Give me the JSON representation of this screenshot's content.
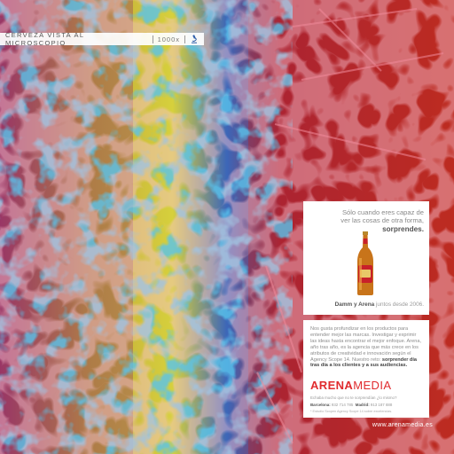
{
  "header": {
    "title": "CERVEZA VISTA AL MICROSCOPIO",
    "zoom": "1000x",
    "icon": "microscope-icon"
  },
  "ad": {
    "tagline_line1": "Sólo cuando eres capaz de",
    "tagline_line2": "ver las cosas de otra forma,",
    "tagline_bold": "sorprendes.",
    "together_bold": "Damm y Arena",
    "together_rest": " juntos desde 2006.",
    "body_text": "Nos gusta profundizar en los productos para entender mejor las marcas. Investigar y exprimir las ideas hasta encontrar el mejor enfoque. Arena, año tras año, es la agencia que más crece en los atributos de creatividad e innovación según el Agency Scope 14. Nuestro reto:",
    "body_bold": " sorprender día tras día a los clientes y a sus audiencias.",
    "logo_bold": "ARENA",
    "logo_light": "MEDIA",
    "slogan": "Echaba mucho que no te sorprendían ¿lo mismo?",
    "phone_label_1": "Barcelona:",
    "phone_1": " 932 714 785",
    "phone_label_2": "Madrid:",
    "phone_2": " 913 187 888",
    "note": "* Estudio Scopen Agency Scope 14 sobre excelencias.",
    "website": "www.arenamedia.es"
  },
  "colors": {
    "brand_red": "#e02b2e",
    "panel": "#ffffff"
  }
}
